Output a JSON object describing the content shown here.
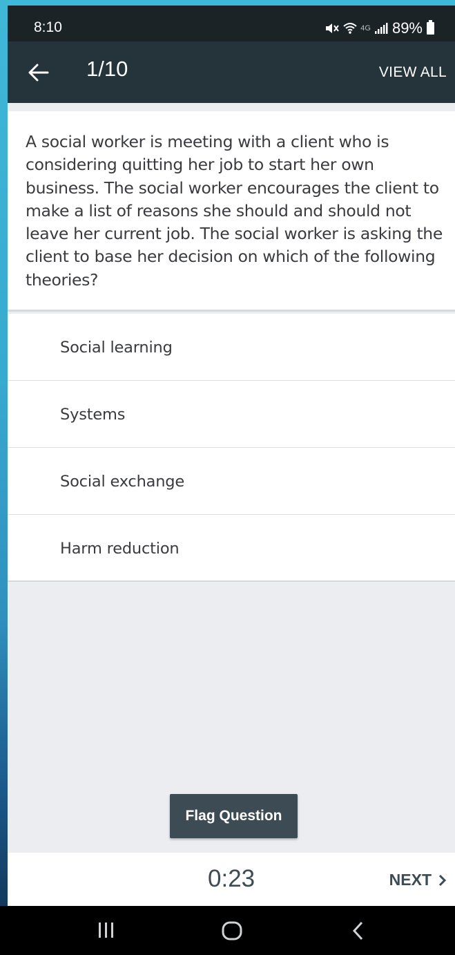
{
  "status_bar": {
    "time": "8:10",
    "network_label": "4G",
    "battery_percent": "89%"
  },
  "app_bar": {
    "counter": "1/10",
    "view_all_label": "VIEW ALL"
  },
  "question": {
    "text": "A social worker is meeting with a client who is considering quitting her job to start her own business. The social worker encourages the client to make a list of reasons she should and should not leave her current job. The social worker is asking the client to base her decision on which of the following theories?"
  },
  "answers": [
    {
      "label": "Social learning"
    },
    {
      "label": "Systems"
    },
    {
      "label": "Social exchange"
    },
    {
      "label": "Harm reduction"
    }
  ],
  "flag_button_label": "Flag Question",
  "footer": {
    "timer": "0:23",
    "next_label": "NEXT"
  },
  "colors": {
    "app_bar": "#25333b",
    "button": "#3d4b54",
    "content_bg": "#ecedf1"
  }
}
